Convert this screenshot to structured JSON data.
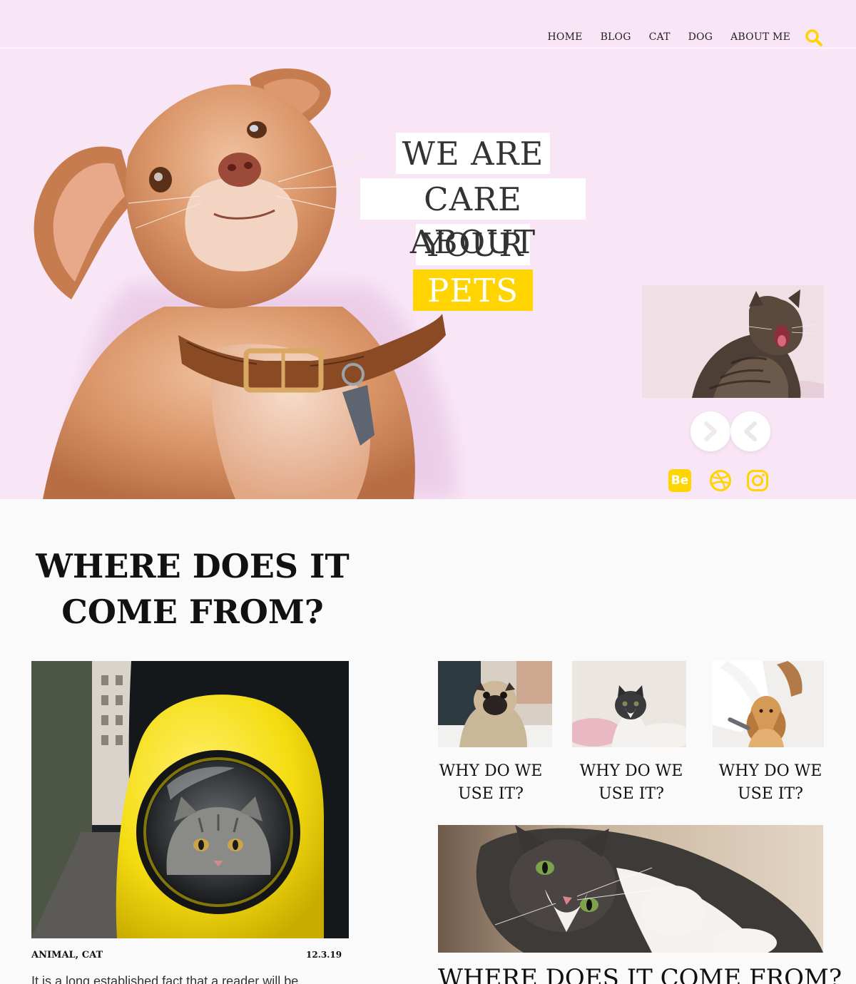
{
  "nav": {
    "items": [
      "HOME",
      "BLOG",
      "CAT",
      "DOG",
      "ABOUT ME"
    ],
    "search_icon": "search-icon"
  },
  "hero": {
    "headline_lines": [
      "WE ARE",
      "CARE ABOUT",
      "YOUR",
      "PETS"
    ],
    "social": {
      "behance_label": "Be",
      "icons": [
        "behance-icon",
        "dribbble-icon",
        "instagram-icon"
      ]
    },
    "arrows": [
      "chevron-right-icon",
      "chevron-left-icon"
    ]
  },
  "section": {
    "title": "WHERE DOES IT COME FROM?"
  },
  "featured_post": {
    "tags": "ANIMAL, CAT",
    "date": "12.3.19",
    "excerpt": "It is a long established fact that a reader will be"
  },
  "cards": [
    {
      "title": "WHY DO WE USE IT?"
    },
    {
      "title": "WHY DO WE USE IT?"
    },
    {
      "title": "WHY DO WE USE IT?"
    }
  ],
  "wide_post": {
    "title": "WHERE DOES IT COME FROM?"
  },
  "colors": {
    "hero_bg": "#f8e6f6",
    "accent_yellow": "#ffd400",
    "page_bg": "#fafafa"
  }
}
